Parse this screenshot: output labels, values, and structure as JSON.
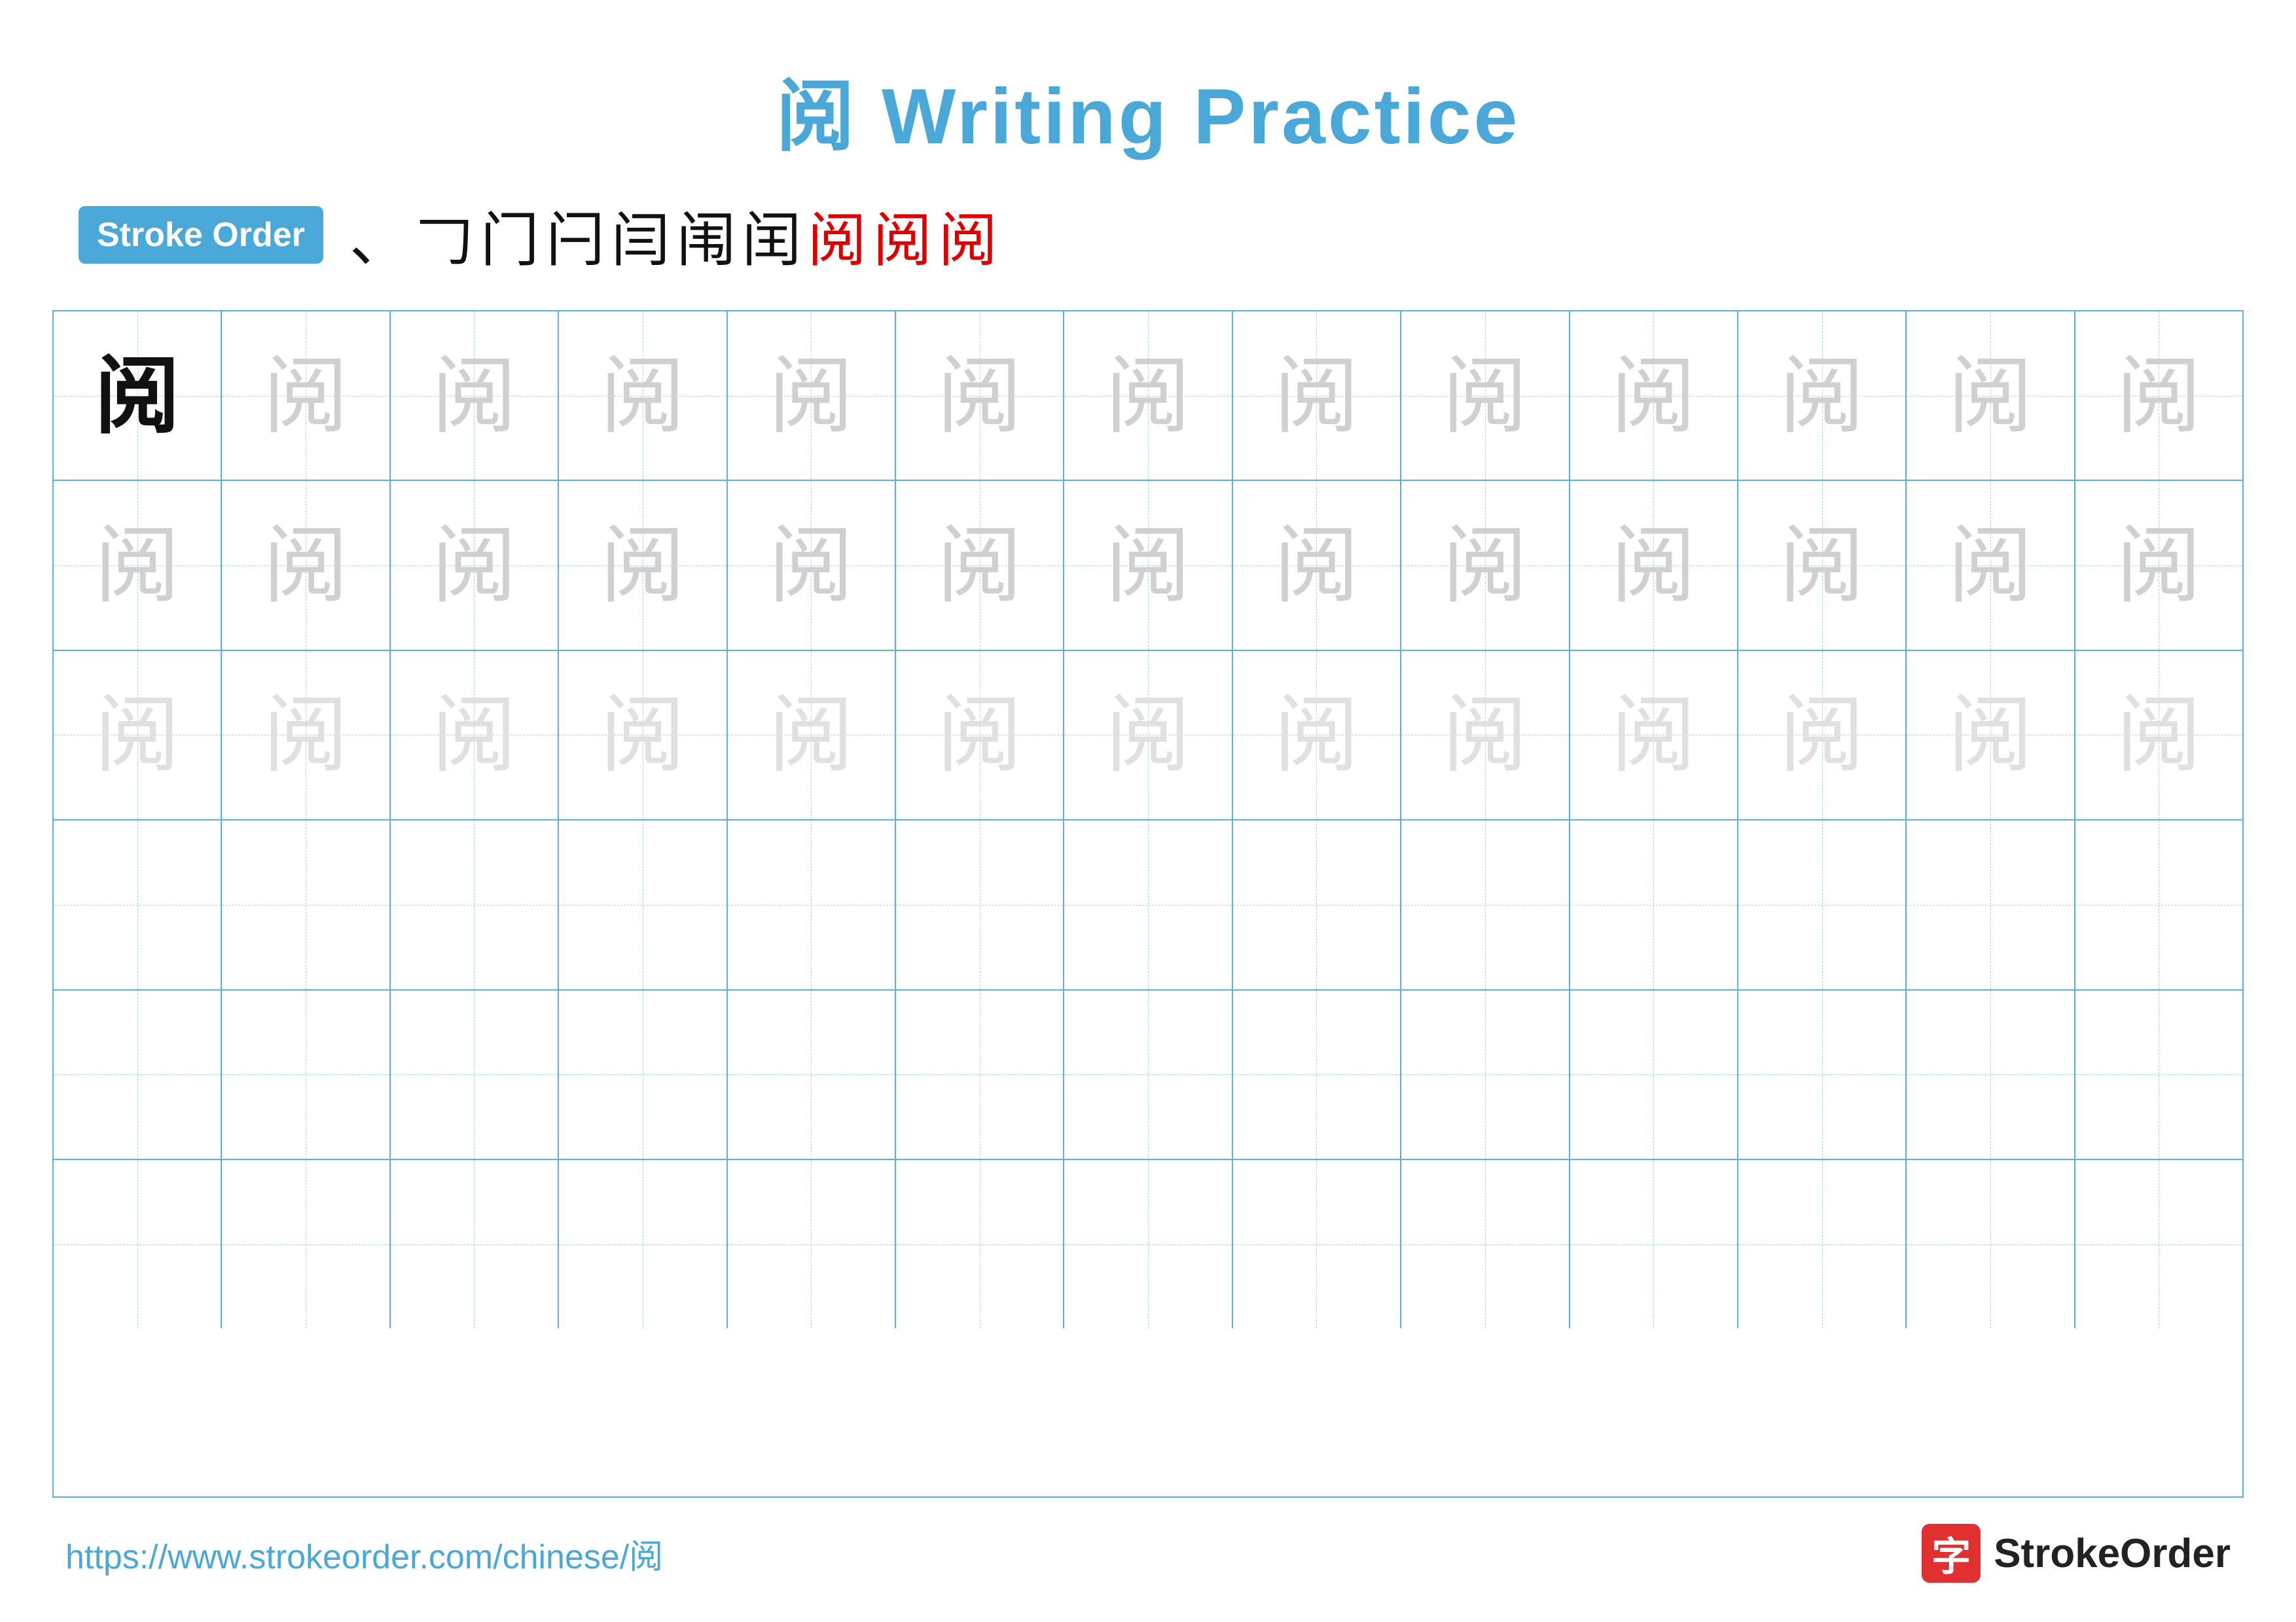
{
  "title": {
    "char": "阅",
    "rest": " Writing Practice"
  },
  "stroke_order": {
    "badge_label": "Stroke Order",
    "strokes": [
      "、",
      "𠃌",
      "门",
      "闩",
      "闫",
      "闱",
      "闰",
      "阅",
      "阅",
      "阅"
    ]
  },
  "grid": {
    "rows": 6,
    "cols": 13,
    "char": "阅",
    "row_types": [
      "dark_then_light",
      "light",
      "lighter",
      "empty",
      "empty",
      "empty"
    ]
  },
  "footer": {
    "url": "https://www.strokeorder.com/chinese/阅",
    "logo_icon": "字",
    "logo_text": "StrokeOrder"
  }
}
